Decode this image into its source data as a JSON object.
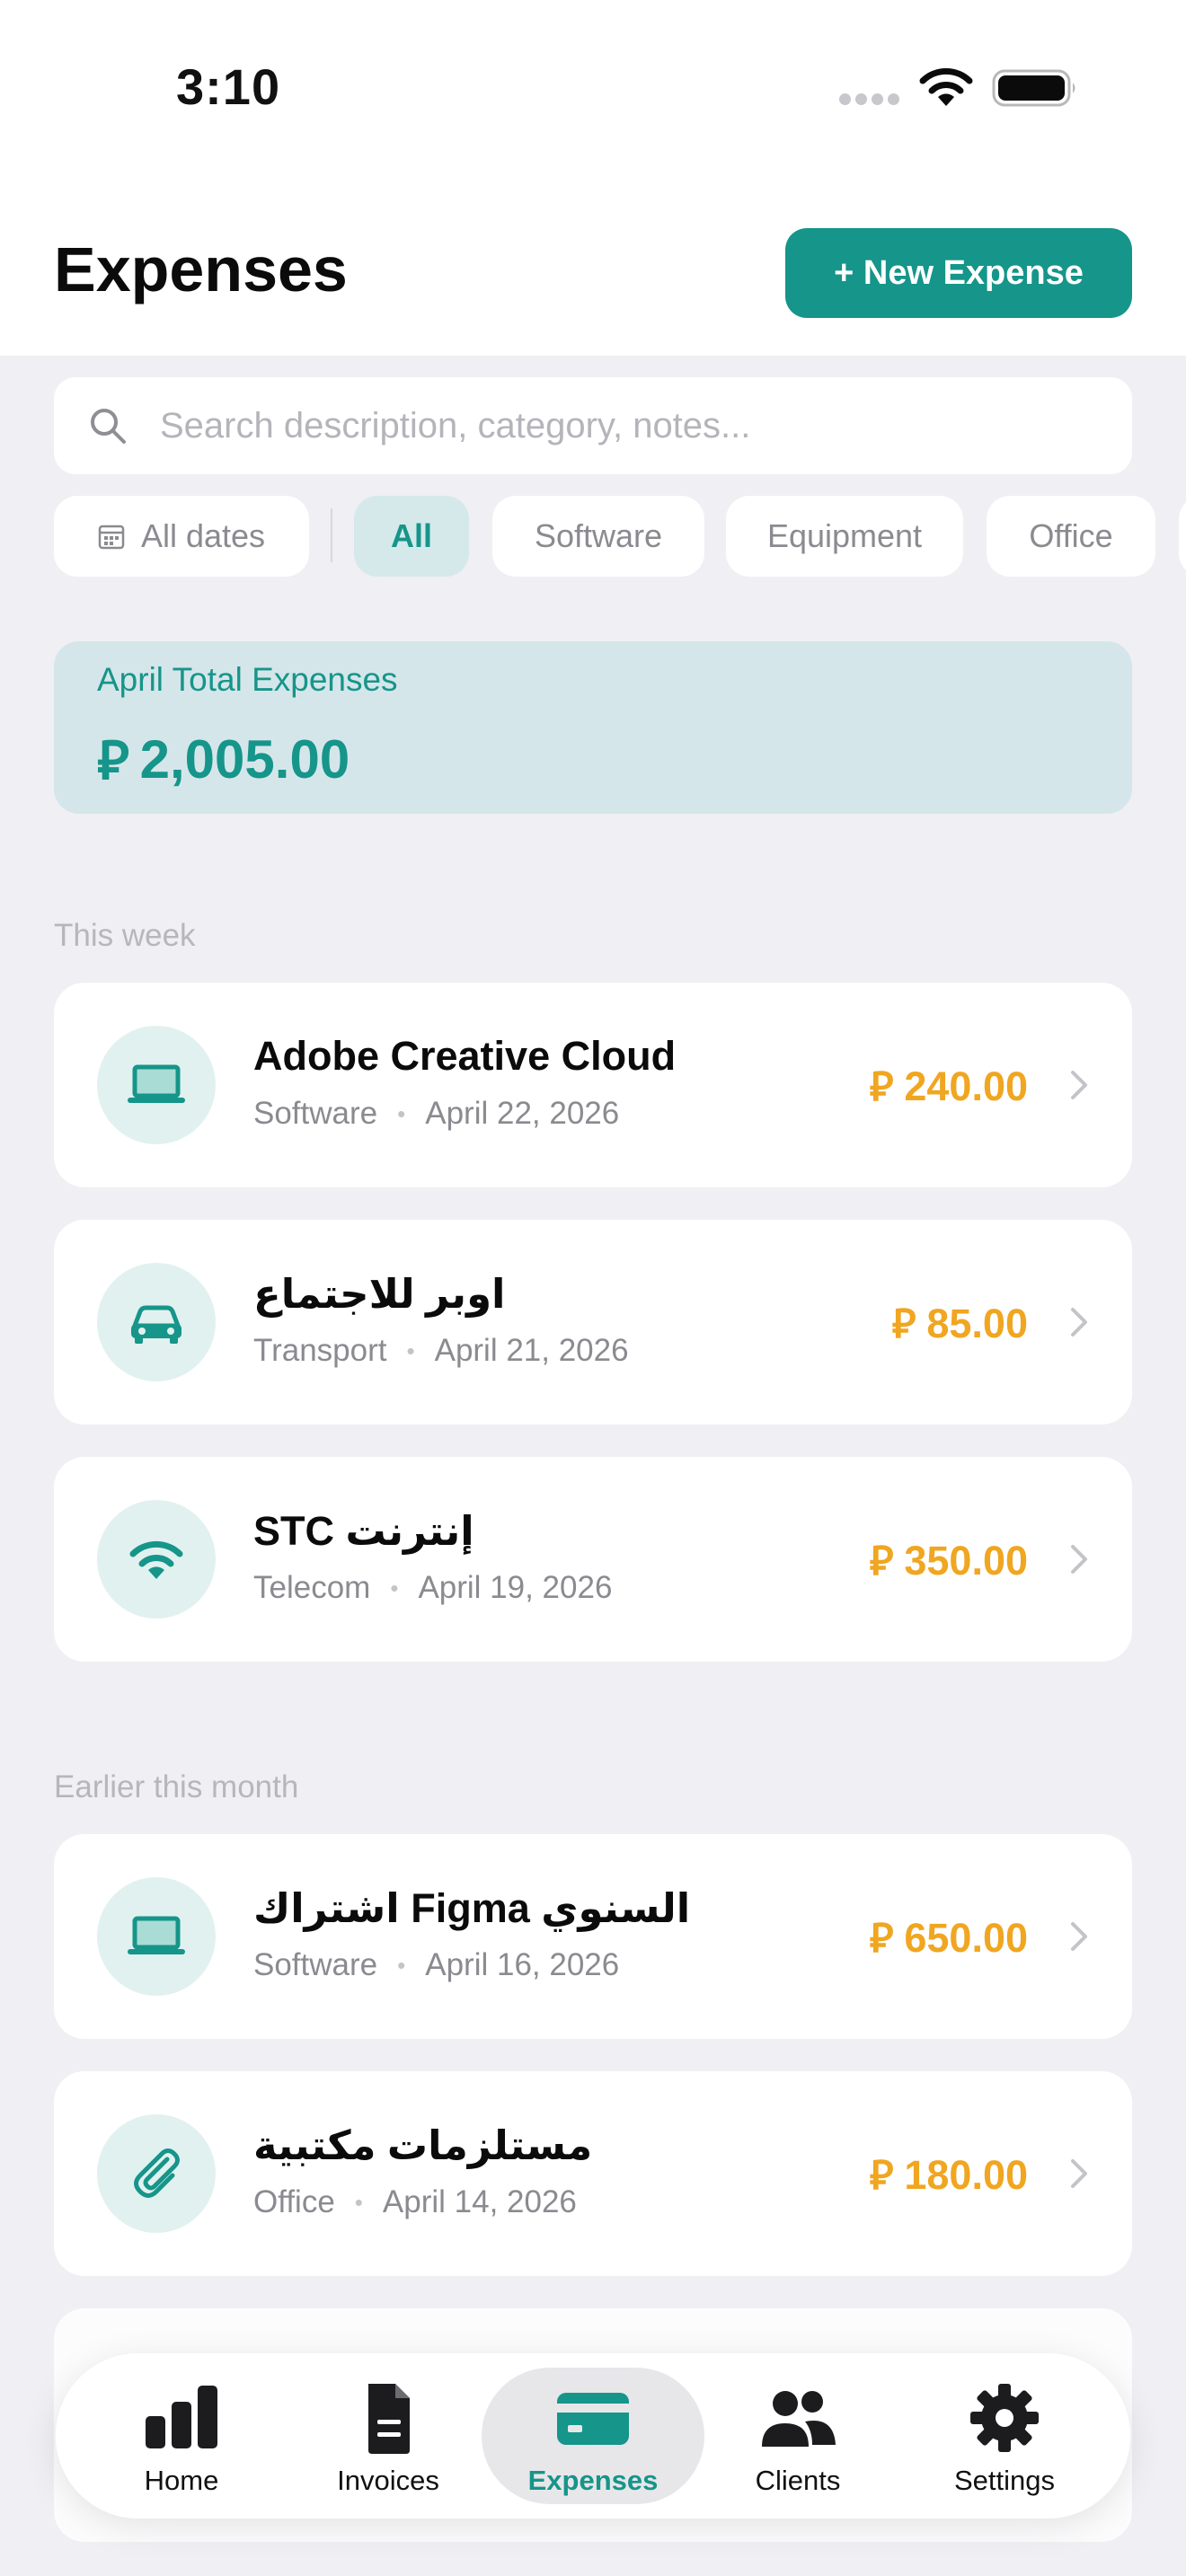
{
  "status_bar": {
    "time": "3:10"
  },
  "header": {
    "title": "Expenses",
    "new_button": "+ New Expense"
  },
  "search": {
    "placeholder": "Search description, category, notes..."
  },
  "filters": {
    "date_label": "All dates",
    "categories": [
      "All",
      "Software",
      "Equipment",
      "Office"
    ],
    "selected": "All"
  },
  "summary": {
    "label": "April Total Expenses",
    "currency_symbol": "⃁",
    "amount": "2,005.00"
  },
  "sections": [
    {
      "label": "This week",
      "items": [
        {
          "title": "Adobe Creative Cloud",
          "category": "Software",
          "date": "April 22, 2026",
          "amount": "240.00",
          "icon": "laptop-icon"
        },
        {
          "title": "اوبر للاجتماع",
          "category": "Transport",
          "date": "April 21, 2026",
          "amount": "85.00",
          "icon": "car-icon"
        },
        {
          "title": "STC إنترنت",
          "category": "Telecom",
          "date": "April 19, 2026",
          "amount": "350.00",
          "icon": "wifi-icon"
        }
      ]
    },
    {
      "label": "Earlier this month",
      "items": [
        {
          "title": "اشتراك Figma السنوي",
          "category": "Software",
          "date": "April 16, 2026",
          "amount": "650.00",
          "icon": "laptop-icon"
        },
        {
          "title": "مستلزمات مكتبية",
          "category": "Office",
          "date": "April 14, 2026",
          "amount": "180.00",
          "icon": "paperclip-icon"
        }
      ]
    }
  ],
  "tabs": [
    {
      "label": "Home",
      "icon": "chart-icon"
    },
    {
      "label": "Invoices",
      "icon": "document-icon"
    },
    {
      "label": "Expenses",
      "icon": "card-icon",
      "active": true
    },
    {
      "label": "Clients",
      "icon": "people-icon"
    },
    {
      "label": "Settings",
      "icon": "gear-icon"
    }
  ],
  "colors": {
    "accent": "#16958A",
    "amount": "#F0A620",
    "summary_bg": "#D5E6EA",
    "icon_bg": "#E1F1EF",
    "background": "#EFEFF4"
  }
}
